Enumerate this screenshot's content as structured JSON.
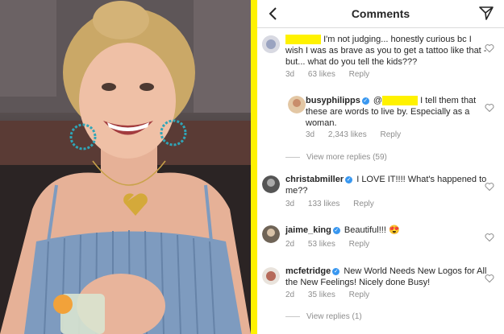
{
  "header": {
    "title": "Comments"
  },
  "comments": [
    {
      "user": "",
      "text": "I'm not judging... honestly curious bc I wish I was as brave as you to get a tattoo like that - but... what do you tell the kids???",
      "time": "3d",
      "likes": "63 likes",
      "reply": "Reply"
    },
    {
      "user": "busyphilipps",
      "mention": "@",
      "text": "I tell them that these are words to live by. Especially as a woman.",
      "time": "3d",
      "likes": "2,343 likes",
      "reply": "Reply"
    },
    {
      "user": "christabmiller",
      "text": "I LOVE IT!!!! What's happened to me??",
      "time": "3d",
      "likes": "133 likes",
      "reply": "Reply"
    },
    {
      "user": "jaime_king",
      "text": "Beautiful!!! 😍",
      "time": "2d",
      "likes": "53 likes",
      "reply": "Reply"
    },
    {
      "user": "mcfetridge",
      "text": "New World Needs New Logos for All the  New Feelings! Nicely done Busy!",
      "time": "2d",
      "likes": "35 likes",
      "reply": "Reply"
    }
  ],
  "view_more_replies": "View more replies (59)",
  "view_replies": "View replies (1)"
}
